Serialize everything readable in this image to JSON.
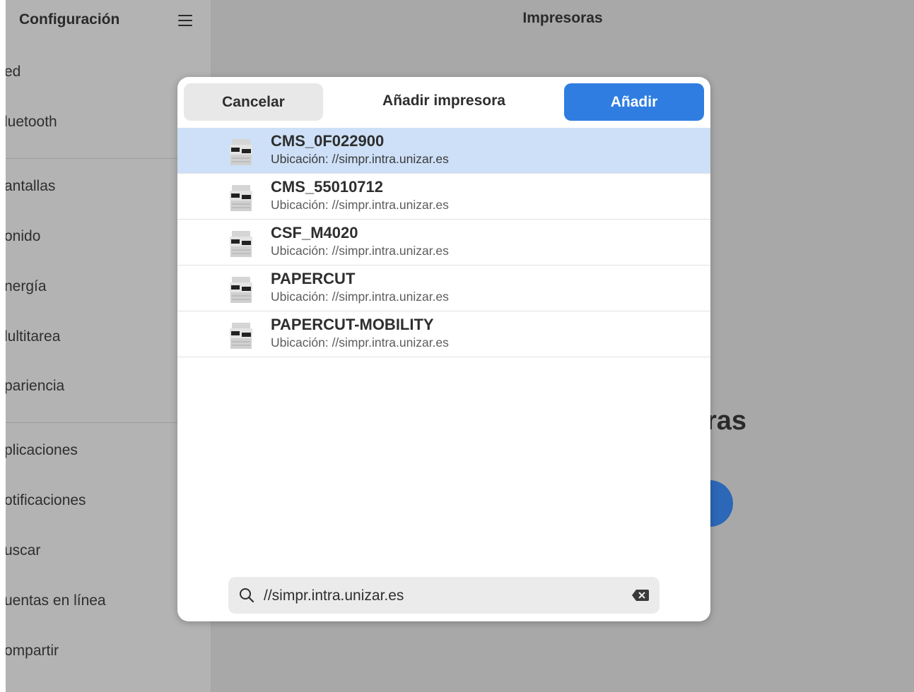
{
  "sidebar": {
    "title": "Configuración",
    "items": [
      {
        "label": "ed"
      },
      {
        "label": "luetooth"
      },
      {
        "label": "antallas"
      },
      {
        "label": "onido"
      },
      {
        "label": "nergía"
      },
      {
        "label": "lultitarea"
      },
      {
        "label": "pariencia"
      },
      {
        "label": "plicaciones"
      },
      {
        "label": "otificaciones"
      },
      {
        "label": "uscar"
      },
      {
        "label": "uentas en línea"
      },
      {
        "label": "ompartir"
      }
    ]
  },
  "main": {
    "title": "Impresoras",
    "partial_heading": "ras"
  },
  "dialog": {
    "title": "Añadir impresora",
    "cancel_label": "Cancelar",
    "add_label": "Añadir",
    "printers": [
      {
        "name": "CMS_0F022900",
        "location": "Ubicación: //simpr.intra.unizar.es",
        "selected": true
      },
      {
        "name": "CMS_55010712",
        "location": "Ubicación: //simpr.intra.unizar.es",
        "selected": false
      },
      {
        "name": "CSF_M4020",
        "location": "Ubicación: //simpr.intra.unizar.es",
        "selected": false
      },
      {
        "name": "PAPERCUT",
        "location": "Ubicación: //simpr.intra.unizar.es",
        "selected": false
      },
      {
        "name": "PAPERCUT-MOBILITY",
        "location": "Ubicación: //simpr.intra.unizar.es",
        "selected": false
      }
    ],
    "search": {
      "value": "//simpr.intra.unizar.es"
    }
  },
  "colors": {
    "accent": "#2f7de1",
    "selected_row": "#cde0f7"
  }
}
